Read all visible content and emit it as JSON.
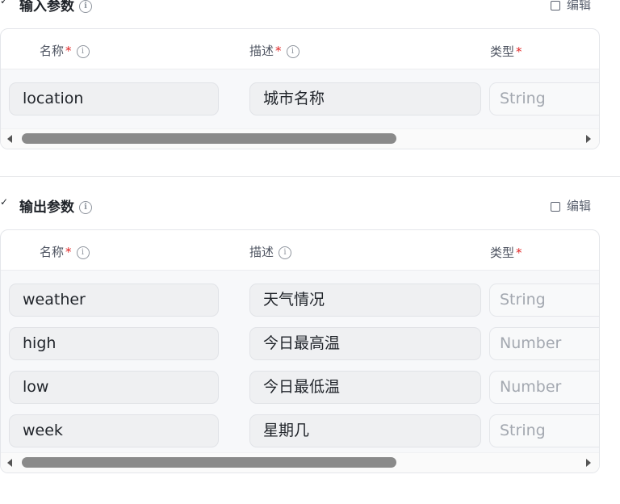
{
  "input_section": {
    "title": "输入参数",
    "edit_label": "编辑",
    "headers": {
      "name": "名称",
      "desc": "描述",
      "type": "类型",
      "required_mark": "*"
    },
    "rows": [
      {
        "name": "location",
        "desc": "城市名称",
        "type": "String"
      }
    ]
  },
  "output_section": {
    "title": "输出参数",
    "edit_label": "编辑",
    "headers": {
      "name": "名称",
      "desc": "描述",
      "type": "类型",
      "required_mark": "*"
    },
    "rows": [
      {
        "name": "weather",
        "desc": "天气情况",
        "type": "String"
      },
      {
        "name": "high",
        "desc": "今日最高温",
        "type": "Number"
      },
      {
        "name": "low",
        "desc": "今日最低温",
        "type": "Number"
      },
      {
        "name": "week",
        "desc": "星期几",
        "type": "String"
      }
    ]
  },
  "icons": {
    "collapse": "chevron-down-icon",
    "info": "info-icon",
    "edit": "edit-icon"
  },
  "colors": {
    "required": "#e02424",
    "placeholder_text": "#a3a8b0",
    "input_bg": "#eff0f2"
  }
}
